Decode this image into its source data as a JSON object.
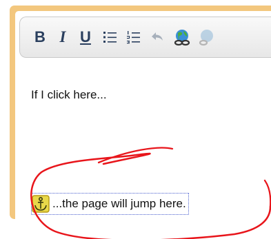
{
  "toolbar": {
    "bold_label": "B",
    "italic_label": "I",
    "underline_label": "U",
    "icons": [
      "bullet-list-icon",
      "numbered-list-icon",
      "undo-icon",
      "insert-link-icon",
      "insert-link-disabled-icon"
    ]
  },
  "content": {
    "line1": "If I click here...",
    "line2": "...the page will jump here.",
    "anchor_icon": "anchor-icon"
  },
  "colors": {
    "frame": "#f3c77e",
    "toolbar_icon": "#2a3f5e",
    "annotation": "#e8151b",
    "selection_border": "#4a5fcf"
  }
}
